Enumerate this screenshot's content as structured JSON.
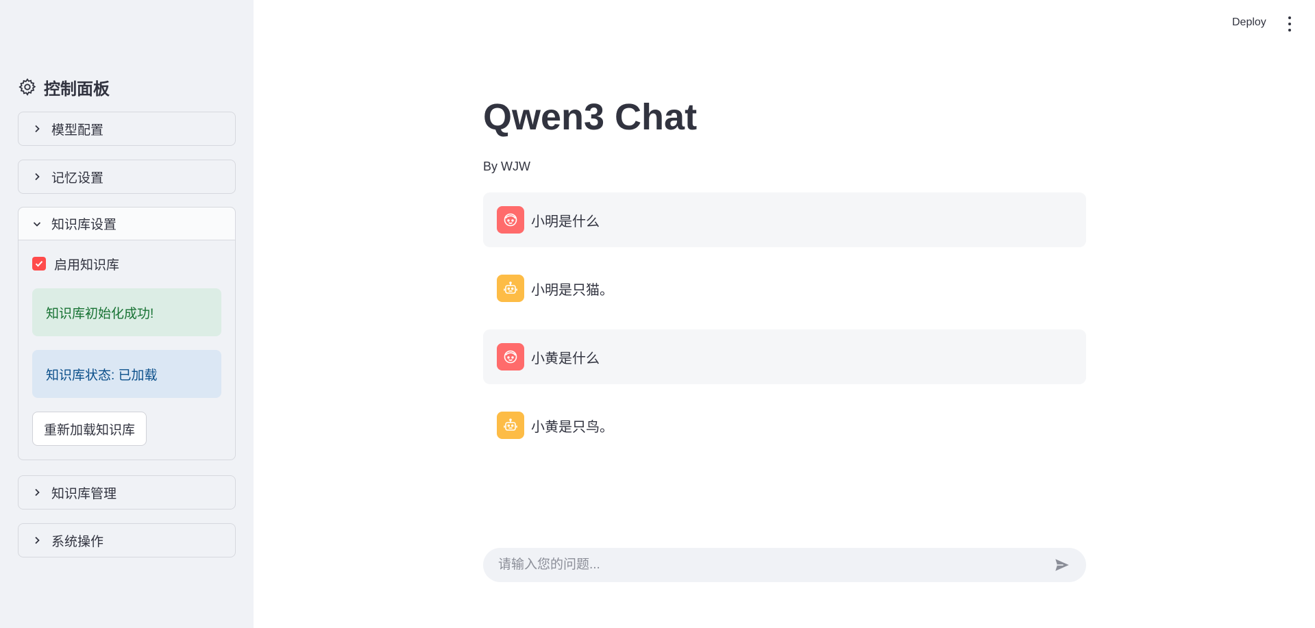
{
  "sidebar": {
    "title": "控制面板",
    "title_icon": "gear-icon",
    "expanders": [
      {
        "label": "模型配置",
        "expanded": false
      },
      {
        "label": "记忆设置",
        "expanded": false
      },
      {
        "label": "知识库设置",
        "expanded": true
      },
      {
        "label": "知识库管理",
        "expanded": false
      },
      {
        "label": "系统操作",
        "expanded": false
      }
    ],
    "knowledge": {
      "checkbox_label": "启用知识库",
      "checked": true,
      "success_msg": "知识库初始化成功!",
      "status_msg": "知识库状态: 已加载",
      "reload_button": "重新加载知识库"
    }
  },
  "header": {
    "deploy_label": "Deploy",
    "menu_icon": "more-vertical-icon"
  },
  "main": {
    "title": "Qwen3 Chat",
    "byline": "By WJW",
    "messages": [
      {
        "role": "user",
        "text": "小明是什么"
      },
      {
        "role": "assistant",
        "text": "小明是只猫。"
      },
      {
        "role": "user",
        "text": "小黄是什么"
      },
      {
        "role": "assistant",
        "text": "小黄是只鸟。"
      }
    ],
    "input_placeholder": "请输入您的问题..."
  },
  "colors": {
    "sidebar_bg": "#f0f2f6",
    "accent_red": "#ff4b4b",
    "user_avatar": "#ff6b6b",
    "bot_avatar": "#fdbc46",
    "success_bg": "#dcede5",
    "success_text": "#177233",
    "info_bg": "#dbe7f4",
    "info_text": "#0b4f8a"
  }
}
